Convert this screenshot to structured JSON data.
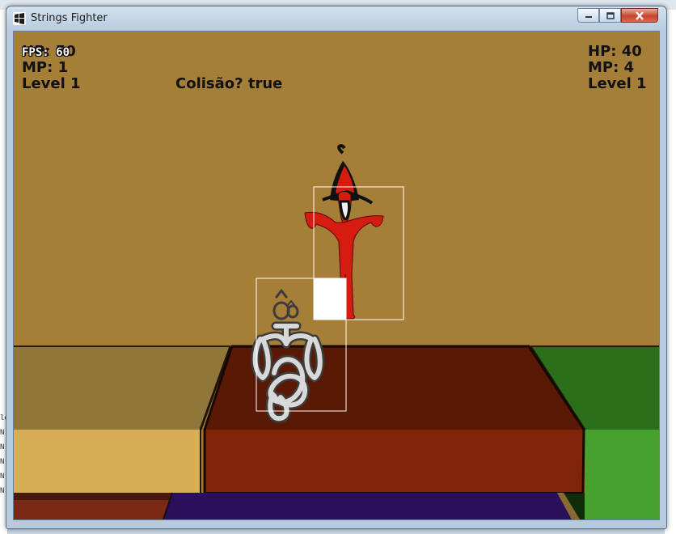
{
  "window": {
    "title": "Strings Fighter"
  },
  "hud": {
    "fps": "FPS: 60",
    "p1_hp": "HP: 50",
    "p1_mp": "MP: 1",
    "p1_level": "Level 1",
    "collision": "Colisão? true",
    "p2_hp": "HP: 40",
    "p2_mp": "MP: 4",
    "p2_level": "Level 1"
  },
  "colors": {
    "wall": "#a57e38",
    "platform_top": "#5a1905",
    "platform_front": "#7f2409",
    "left_block_top": "#907638",
    "left_block_front": "#d6ae56",
    "right_block_top": "#2c6f1a",
    "right_block_front": "#47a12f",
    "floor_band": "#2a0f5a",
    "enemy_red": "#d61b10",
    "player_white": "#d8d8d8"
  }
}
